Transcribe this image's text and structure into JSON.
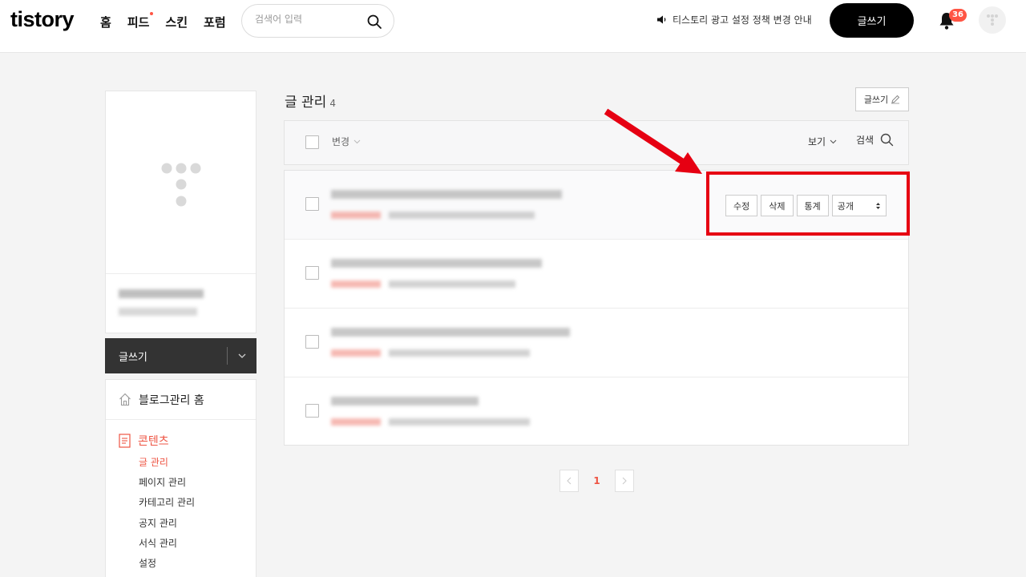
{
  "header": {
    "logo": "tistory",
    "nav": [
      {
        "label": "홈",
        "has_new": false
      },
      {
        "label": "피드",
        "has_new": true
      },
      {
        "label": "스킨",
        "has_new": false
      },
      {
        "label": "포럼",
        "has_new": false
      }
    ],
    "search": {
      "placeholder": "검색어 입력",
      "value": ""
    },
    "notice": "티스토리 광고 설정 정책 변경 안내",
    "write_button": "글쓰기",
    "notification_count": "36",
    "icons": {
      "search": "search-icon",
      "notice": "speaker-icon",
      "bell": "bell-icon",
      "avatar": "tistory-logo-icon"
    }
  },
  "sidebar": {
    "write_button": "글쓰기",
    "home": "블로그관리 홈",
    "section": "콘텐츠",
    "items": [
      {
        "label": "글 관리",
        "active": true
      },
      {
        "label": "페이지 관리",
        "active": false
      },
      {
        "label": "카테고리 관리",
        "active": false
      },
      {
        "label": "공지 관리",
        "active": false
      },
      {
        "label": "서식 관리",
        "active": false
      },
      {
        "label": "설정",
        "active": false
      }
    ]
  },
  "main": {
    "title": "글 관리",
    "count": "4",
    "write_button": "글쓰기",
    "toolbar": {
      "change": "변경",
      "view": "보기",
      "search": "검색"
    },
    "row_actions": {
      "edit": "수정",
      "delete": "삭제",
      "stats": "통계",
      "visibility": "공개"
    },
    "post_count": 4
  },
  "pagination": {
    "current": "1"
  },
  "colors": {
    "accent": "#ee5544",
    "annotation": "#e60012",
    "header_button": "#000000",
    "sidebar_button": "#333333"
  }
}
